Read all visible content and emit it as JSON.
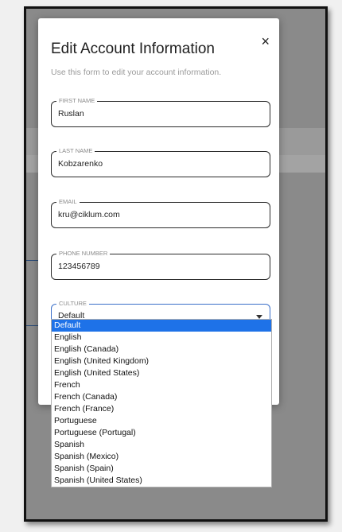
{
  "dialog": {
    "title": "Edit Account Information",
    "close_label": "×",
    "subtitle": "Use this form to edit your account information."
  },
  "fields": {
    "first_name": {
      "label": "FIRST NAME",
      "value": "Ruslan"
    },
    "last_name": {
      "label": "LAST NAME",
      "value": "Kobzarenko"
    },
    "email": {
      "label": "EMAIL",
      "value": "kru@ciklum.com"
    },
    "phone": {
      "label": "PHONE NUMBER",
      "value": "123456789"
    },
    "culture": {
      "label": "CULTURE",
      "value": "Default",
      "options": [
        "Default",
        "English",
        "English (Canada)",
        "English (United Kingdom)",
        "English (United States)",
        "French",
        "French (Canada)",
        "French (France)",
        "Portuguese",
        "Portuguese (Portugal)",
        "Spanish",
        "Spanish (Mexico)",
        "Spanish (Spain)",
        "Spanish (United States)"
      ],
      "selected_index": 0
    }
  },
  "colors": {
    "selected_option_bg": "#1e72e8",
    "select_border": "#3a6fc9",
    "backdrop": "#8a8a8a"
  },
  "icons": {
    "close": "close-icon",
    "dropdown": "chevron-down-icon"
  }
}
